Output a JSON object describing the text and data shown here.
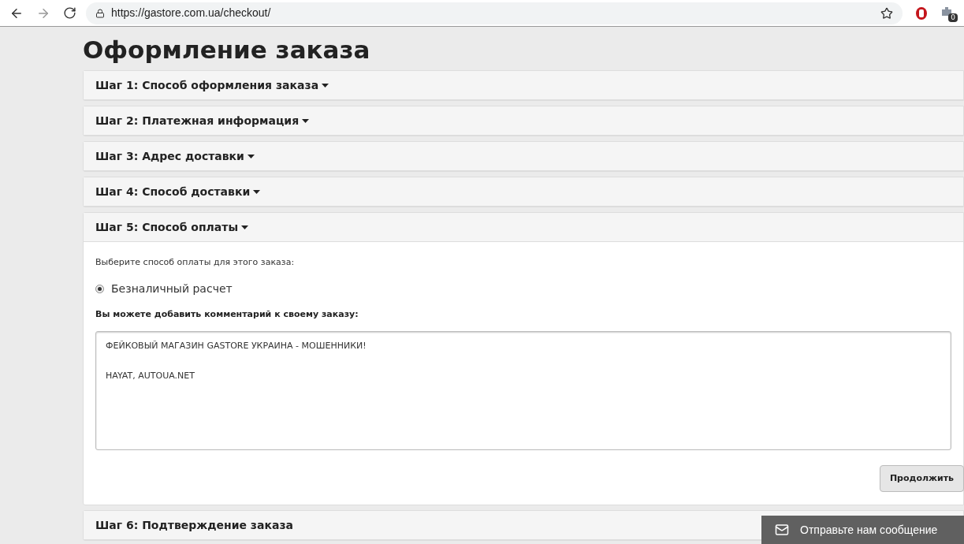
{
  "browser": {
    "url": "https://gastore.com.ua/checkout/",
    "extension_badge": "0"
  },
  "page_title": "Оформление заказа",
  "steps": [
    {
      "title": "Шаг 1: Способ оформления заказа",
      "has_caret": true,
      "expanded": false
    },
    {
      "title": "Шаг 2: Платежная информация",
      "has_caret": true,
      "expanded": false
    },
    {
      "title": "Шаг 3: Адрес доставки",
      "has_caret": true,
      "expanded": false
    },
    {
      "title": "Шаг 4: Способ доставки",
      "has_caret": true,
      "expanded": false
    },
    {
      "title": "Шаг 5: Способ оплаты",
      "has_caret": true,
      "expanded": true
    },
    {
      "title": "Шаг 6: Подтверждение заказа",
      "has_caret": false,
      "expanded": false
    }
  ],
  "payment": {
    "prompt": "Выберите способ оплаты для этого заказа:",
    "options": [
      {
        "label": "Безналичный расчет",
        "selected": true
      }
    ],
    "comment_label": "Вы можете добавить комментарий к своему заказу:",
    "comment_value": "ФЕЙКОВЫЙ МАГАЗИН GASTORE УКРАИНА - МОШЕННИКИ!\n\nHAYAT, AUTOUA.NET",
    "continue_button": "Продолжить"
  },
  "chat_widget": {
    "label": "Отправьте нам сообщение"
  }
}
